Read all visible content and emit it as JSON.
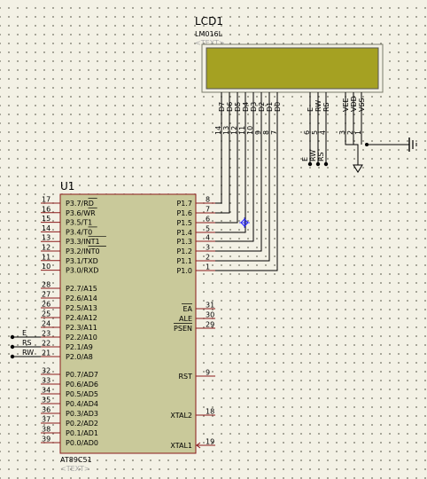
{
  "lcd": {
    "ref": "LCD1",
    "model": "LM016L",
    "text_placeholder": "<TEXT>",
    "pins": [
      {
        "name": "D7",
        "num": "14"
      },
      {
        "name": "D6",
        "num": "13"
      },
      {
        "name": "D5",
        "num": "12"
      },
      {
        "name": "D4",
        "num": "11"
      },
      {
        "name": "D3",
        "num": "10"
      },
      {
        "name": "D2",
        "num": "9"
      },
      {
        "name": "D1",
        "num": "8"
      },
      {
        "name": "D0",
        "num": "7"
      },
      {
        "name": "E",
        "num": "6"
      },
      {
        "name": "RW",
        "num": "5"
      },
      {
        "name": "RS",
        "num": "4"
      },
      {
        "name": "VEE",
        "num": "3"
      },
      {
        "name": "VDD",
        "num": "2"
      },
      {
        "name": "VSS",
        "num": "1"
      }
    ],
    "net_labels": [
      "E",
      "RW",
      "RS"
    ],
    "colors": {
      "screen": "#a5a122",
      "body_border": "#7a7a6a"
    }
  },
  "mcu": {
    "ref": "U1",
    "model": "AT89C51",
    "text_placeholder": "<TEXT>",
    "left_pins": [
      {
        "num": "17",
        "name": "P3.7/RD"
      },
      {
        "num": "16",
        "name": "P3.6/WR"
      },
      {
        "num": "15",
        "name": "P3.5/T1"
      },
      {
        "num": "14",
        "name": "P3.4/T0"
      },
      {
        "num": "13",
        "name": "P3.3/INT1"
      },
      {
        "num": "12",
        "name": "P3.2/INT0"
      },
      {
        "num": "11",
        "name": "P3.1/TXD"
      },
      {
        "num": "10",
        "name": "P3.0/RXD"
      },
      {
        "num": "28",
        "name": "P2.7/A15"
      },
      {
        "num": "27",
        "name": "P2.6/A14"
      },
      {
        "num": "26",
        "name": "P2.5/A13"
      },
      {
        "num": "25",
        "name": "P2.4/A12"
      },
      {
        "num": "24",
        "name": "P2.3/A11"
      },
      {
        "num": "23",
        "name": "P2.2/A10"
      },
      {
        "num": "22",
        "name": "P2.1/A9"
      },
      {
        "num": "21",
        "name": "P2.0/A8"
      },
      {
        "num": "32",
        "name": "P0.7/AD7"
      },
      {
        "num": "33",
        "name": "P0.6/AD6"
      },
      {
        "num": "34",
        "name": "P0.5/AD5"
      },
      {
        "num": "35",
        "name": "P0.4/AD4"
      },
      {
        "num": "36",
        "name": "P0.3/AD3"
      },
      {
        "num": "37",
        "name": "P0.2/AD2"
      },
      {
        "num": "38",
        "name": "P0.1/AD1"
      },
      {
        "num": "39",
        "name": "P0.0/AD0"
      }
    ],
    "right_pins": [
      {
        "num": "8",
        "name": "P1.7"
      },
      {
        "num": "7",
        "name": "P1.6"
      },
      {
        "num": "6",
        "name": "P1.5"
      },
      {
        "num": "5",
        "name": "P1.4"
      },
      {
        "num": "4",
        "name": "P1.3"
      },
      {
        "num": "3",
        "name": "P1.2"
      },
      {
        "num": "2",
        "name": "P1.1"
      },
      {
        "num": "1",
        "name": "P1.0"
      },
      {
        "num": "31",
        "name": "EA"
      },
      {
        "num": "30",
        "name": "ALE"
      },
      {
        "num": "29",
        "name": "PSEN"
      },
      {
        "num": "9",
        "name": "RST"
      },
      {
        "num": "18",
        "name": "XTAL2"
      },
      {
        "num": "19",
        "name": "XTAL1"
      }
    ],
    "net_labels": [
      "E",
      "RS",
      "RW"
    ],
    "colors": {
      "body_fill": "#c9c99a",
      "body_border": "#8b1a1a",
      "pin_line": "#8b1a1a"
    }
  },
  "colors": {
    "wire": "#000000",
    "background": "#f3f1e5",
    "probe": "#2222ff"
  }
}
